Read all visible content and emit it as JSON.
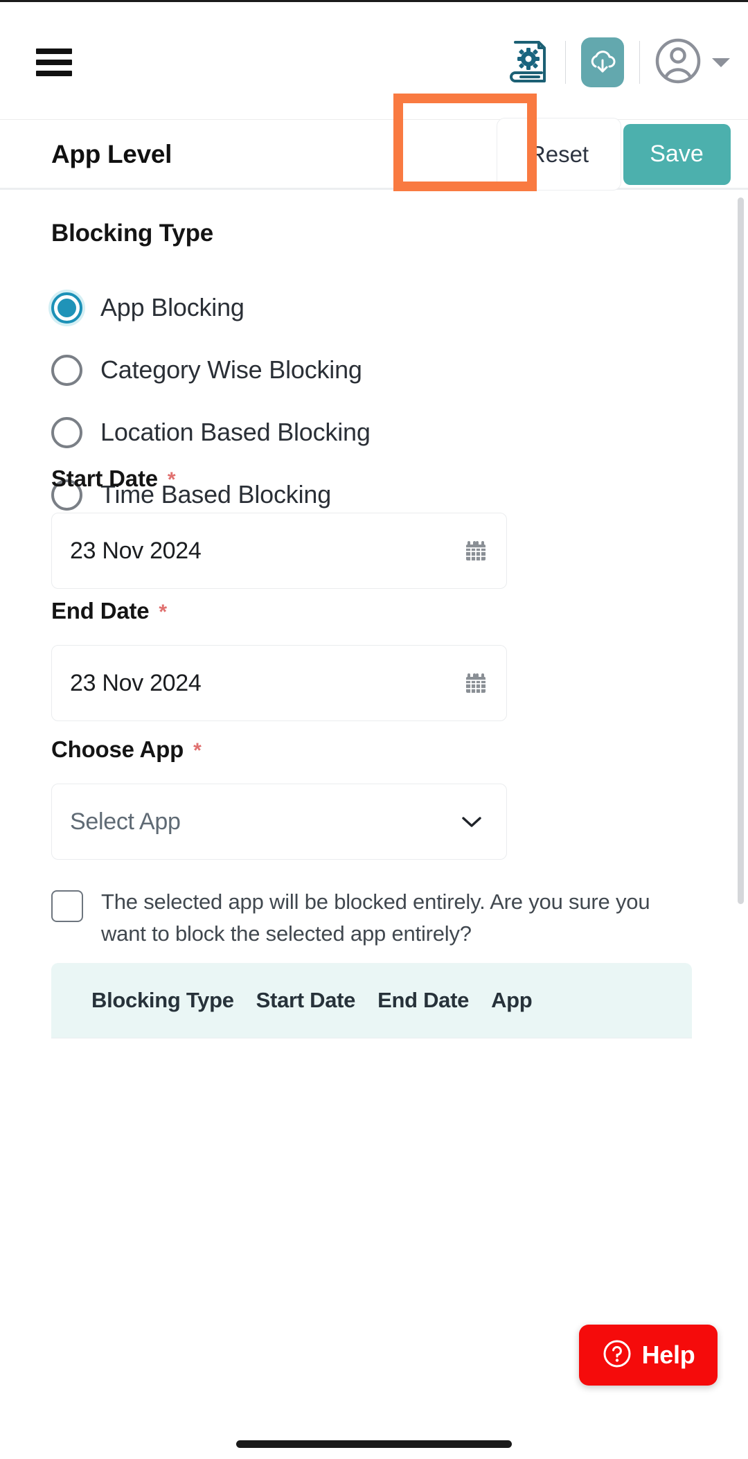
{
  "appbar": {
    "menu_icon": "hamburger-menu-icon",
    "manual_icon": "book-gear-icon",
    "download_icon": "cloud-download-icon",
    "avatar_icon": "user-avatar-icon",
    "caret_icon": "chevron-down-icon",
    "download_button_color": "#63a8ae"
  },
  "page_header": {
    "title": "App Level",
    "reset_label": "Reset",
    "save_label": "Save",
    "save_color": "#4cb0ad",
    "highlight_color": "#f97a41"
  },
  "form": {
    "section_title": "Blocking Type",
    "blocking_type": {
      "selected": "App Blocking",
      "options": [
        {
          "label": "App Blocking",
          "checked": true
        },
        {
          "label": "Category Wise Blocking",
          "checked": false
        },
        {
          "label": "Location Based Blocking",
          "checked": false
        },
        {
          "label": "Time Based Blocking",
          "checked": false
        }
      ]
    },
    "start_date": {
      "label": "Start Date",
      "required_mark": "*",
      "value": "23 Nov 2024",
      "icon": "calendar-icon"
    },
    "end_date": {
      "label": "End Date",
      "required_mark": "*",
      "value": "23 Nov 2024",
      "icon": "calendar-icon"
    },
    "choose_app": {
      "label": "Choose App",
      "required_mark": "*",
      "placeholder": "Select App",
      "icon": "chevron-down-icon"
    },
    "confirm_checkbox": {
      "checked": false,
      "text": "The selected app will be blocked entirely. Are you sure you want to block the selected app entirely?"
    }
  },
  "table": {
    "columns": [
      "Blocking Type",
      "Start Date",
      "End Date",
      "App"
    ],
    "rows": []
  },
  "help": {
    "label": "Help",
    "icon": "question-mark-circle-icon",
    "color": "#f50b0b"
  }
}
